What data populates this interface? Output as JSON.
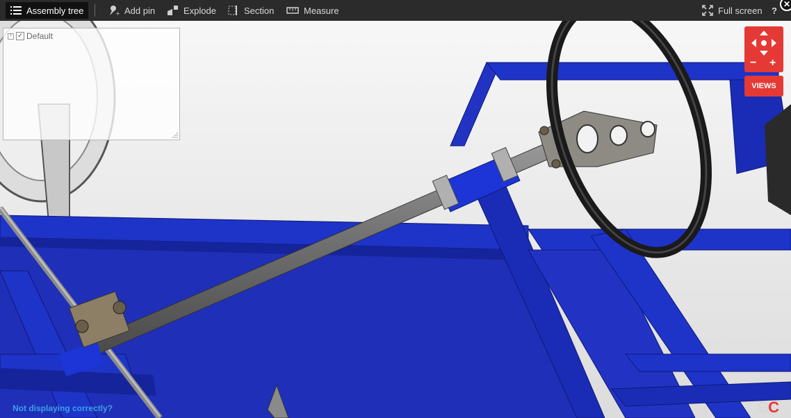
{
  "toolbar": {
    "assembly_tree": "Assembly tree",
    "add_pin": "Add pin",
    "explode": "Explode",
    "section": "Section",
    "measure": "Measure",
    "full_screen": "Full screen",
    "help": "?",
    "close": "✕"
  },
  "tree": {
    "root_label": "Default",
    "checked": true
  },
  "nav": {
    "views_label": "VIEWS",
    "zoom_out": "−",
    "zoom_in": "+"
  },
  "footer": {
    "not_displaying": "Not displaying correctly?",
    "logo_g": "G",
    "logo_c": "C"
  },
  "colors": {
    "toolbar_bg": "#2b2b2b",
    "accent_red": "#e53935",
    "frame_blue": "#1f2fb8",
    "link_blue": "#3aa0e8"
  }
}
